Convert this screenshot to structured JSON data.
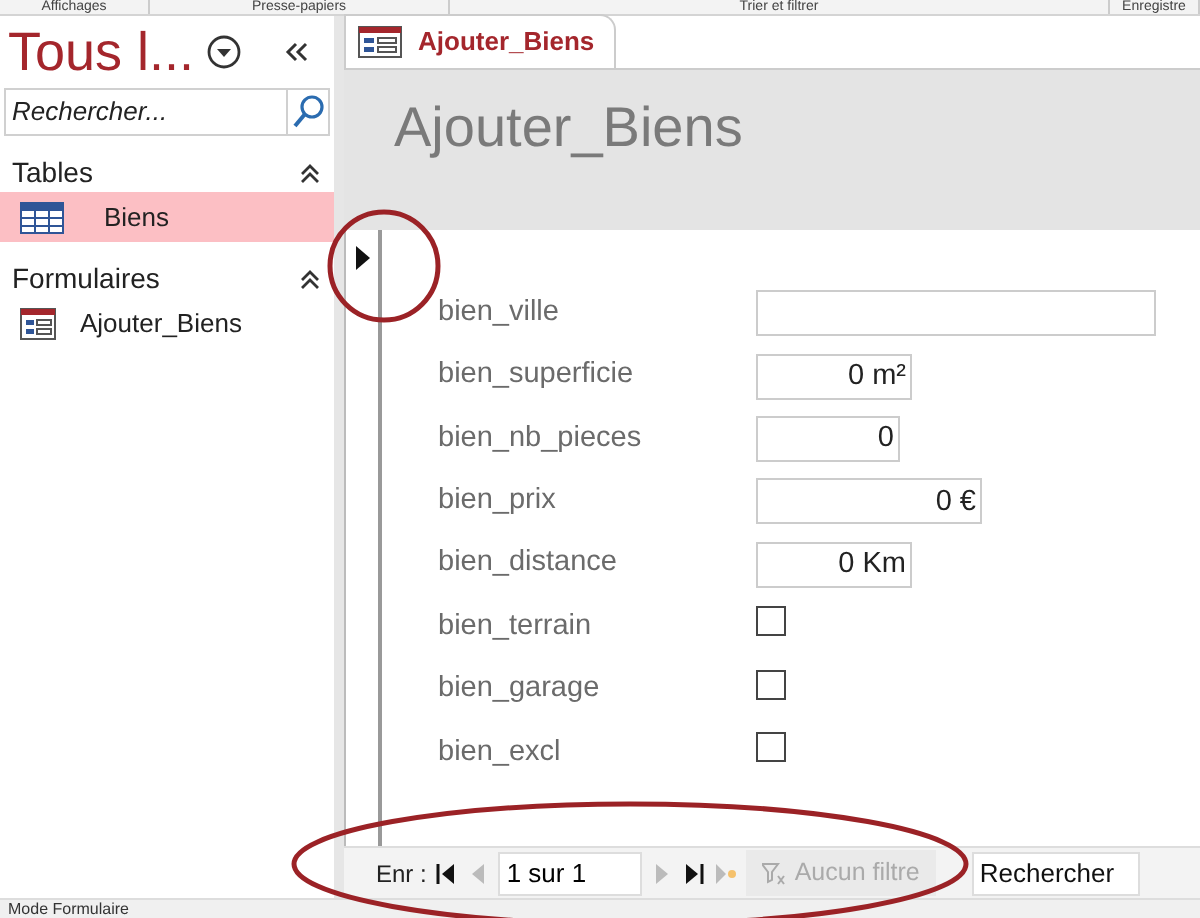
{
  "ribbon_groups": [
    "Affichages",
    "Presse-papiers",
    "Trier et filtrer",
    "Enregistre"
  ],
  "nav_pane": {
    "title": "Tous l...",
    "search": {
      "placeholder": "Rechercher..."
    },
    "groups": [
      {
        "label": "Tables",
        "expanded": true,
        "items": [
          {
            "label": "Biens",
            "kind": "table",
            "selected": true
          }
        ]
      },
      {
        "label": "Formulaires",
        "expanded": true,
        "items": [
          {
            "label": "Ajouter_Biens",
            "kind": "form",
            "selected": false
          }
        ]
      }
    ]
  },
  "tabs": [
    {
      "label": "Ajouter_Biens",
      "selected": true
    }
  ],
  "form": {
    "title": "Ajouter_Biens",
    "fields": [
      {
        "label": "bien_ville",
        "kind": "text"
      },
      {
        "label": "bien_superficie",
        "kind": "text",
        "value": "0 m²"
      },
      {
        "label": "bien_nb_pieces",
        "kind": "text",
        "value": "0"
      },
      {
        "label": "bien_prix",
        "kind": "text",
        "value": "0 €"
      },
      {
        "label": "bien_distance",
        "kind": "text",
        "value": "0 Km"
      },
      {
        "label": "bien_terrain",
        "kind": "checkbox",
        "checked": false
      },
      {
        "label": "bien_garage",
        "kind": "checkbox",
        "checked": false
      },
      {
        "label": "bien_excl",
        "kind": "checkbox",
        "checked": false
      }
    ]
  },
  "record_nav": {
    "label": "Enr :",
    "position": "1 sur 1",
    "filter": {
      "label": "Aucun filtre",
      "disabled": true
    },
    "search": {
      "value": "Rechercher"
    }
  },
  "status_bar": "Mode Formulaire"
}
